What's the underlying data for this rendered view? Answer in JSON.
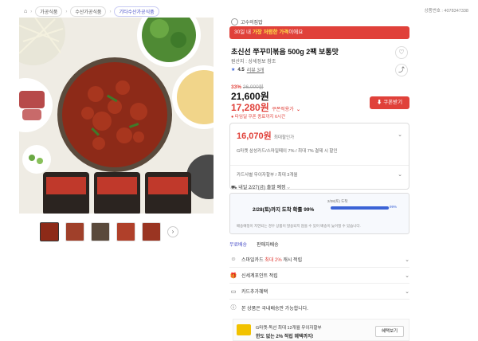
{
  "breadcrumb": {
    "items": [
      "홈",
      "가공식품",
      "수산가공식품",
      "기타수산가공식품"
    ],
    "home_icon": "home-icon"
  },
  "product_number": "상품번호 : 4078347338",
  "seller": {
    "name": "고수의집밥",
    "icon": "store-icon"
  },
  "banner": {
    "pre": "30일 내 ",
    "highlight": "가장 저렴한 가격",
    "post": "이에요"
  },
  "title": "초신선 쭈꾸미볶음 500g 2팩 보통맛",
  "origin": "원산지 : 상세정보 참조",
  "rating": {
    "score": "4.5",
    "reviews": "리뷰 3개"
  },
  "pricing": {
    "discount_pct": "33%",
    "original_price": "26,000원",
    "sale_price": "21,600원",
    "coupon_price": "17,280원",
    "coupon_label": "쿠폰적용가",
    "deadline_note": "● 타임딜 쿠폰 종료까지 6시간",
    "coupon_button": "쿠폰받기"
  },
  "best_price": {
    "amount": "16,070원",
    "label": "최대할인가",
    "line1": "G마켓 삼성카드/스마일페이 7% / 최대 7% 결제 시 할인",
    "line2": "카드사별 무이자할부 / 최대 3개월"
  },
  "delivery": {
    "header": "내일 2/27(금) 출발 예정",
    "main": "2/28(토)까지 도착 확률 99%",
    "bar_label": "2/28(토) 도착",
    "bar_pct": "99%",
    "bar_fill_pct": 99,
    "note": "배송예정이 지연되는 경우 상품이 발송되지 않을 수 있어 배송이 늦어질 수 있습니다.",
    "tabs": [
      "무료배송",
      "판매자배송"
    ]
  },
  "info_rows": [
    {
      "icon": "smile-icon",
      "pre": "스마일카드 ",
      "highlight": "최대 2%",
      "post": " 캐시 적립"
    },
    {
      "icon": "gift-icon",
      "pre": "신세계포인트 적립",
      "highlight": "",
      "post": ""
    },
    {
      "icon": "card-icon",
      "pre": "카드추가혜택",
      "highlight": "",
      "post": ""
    },
    {
      "icon": "info-icon",
      "pre": "본 상품은 국내배송만 가능합니다.",
      "highlight": "",
      "post": ""
    }
  ],
  "promo": {
    "line1": "G마켓-독선 최대 12개월 무이자할부",
    "line2": "한도 없는 2% 적립 혜택까지!",
    "button": "혜택보기"
  },
  "colors": {
    "accent_red": "#e0413a",
    "link_blue": "#4a50c8",
    "bar_blue": "#3b63d6"
  },
  "icons": {
    "heart": "heart-icon",
    "share": "share-icon",
    "chevron": "chevron-down-icon",
    "prev": "chevron-left-icon",
    "next": "chevron-right-icon"
  }
}
